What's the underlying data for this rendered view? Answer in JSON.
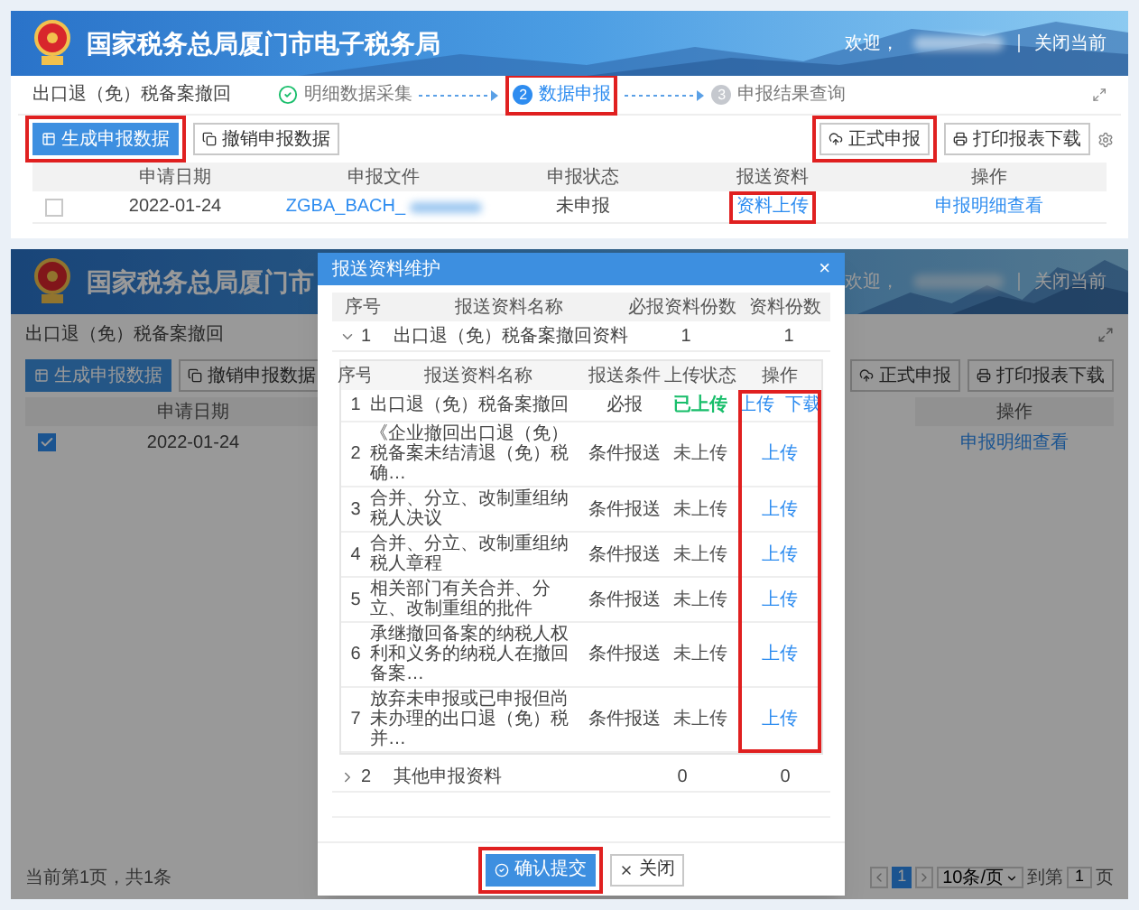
{
  "top_screen": {
    "header": {
      "title": "国家税务总局厦门市电子税务局",
      "welcome": "欢迎，",
      "logout": "关闭当前"
    },
    "breadcrumb": "出口退（免）税备案撤回",
    "steps": [
      {
        "label": "明细数据采集",
        "done": true,
        "selected": false,
        "highlighted": false
      },
      {
        "number": "2",
        "label": "数据申报",
        "done": false,
        "selected": true,
        "highlighted": true
      },
      {
        "number": "3",
        "label": "申报结果查询",
        "done": false,
        "selected": false,
        "highlighted": false
      }
    ],
    "toolbar_left": [
      {
        "label": "生成申报数据",
        "kind": "primary",
        "highlighted": true
      },
      {
        "label": "撤销申报数据",
        "kind": "default",
        "highlighted": false
      }
    ],
    "toolbar_right": [
      {
        "label": "正式申报",
        "kind": "default",
        "highlighted": true
      },
      {
        "label": "打印报表下载",
        "kind": "default",
        "highlighted": false
      }
    ],
    "columns": [
      "申请日期",
      "申报文件",
      "申报状态",
      "报送资料",
      "操作"
    ],
    "rows": [
      {
        "checked": false,
        "date": "2022-01-24",
        "file": "ZGBA_BACH_",
        "status": "未申报",
        "material": "资料上传",
        "material_highlighted": true,
        "action": "申报明细查看"
      }
    ]
  },
  "bottom_screen": {
    "header": {
      "title": "国家税务总局厦门市",
      "welcome": "欢迎，",
      "logout": "关闭当前"
    },
    "breadcrumb": "出口退（免）税备案撤回",
    "toolbar_left": [
      {
        "label": "生成申报数据",
        "kind": "primary",
        "highlighted": false
      },
      {
        "label": "撤销申报数据",
        "kind": "default",
        "highlighted": false
      }
    ],
    "toolbar_right": [
      {
        "label": "正式申报",
        "kind": "default",
        "highlighted": false
      },
      {
        "label": "打印报表下载",
        "kind": "default",
        "highlighted": false
      }
    ],
    "column_left": "申请日期",
    "column_right": "操作",
    "rows": [
      {
        "checked": true,
        "date": "2022-01-24",
        "action": "申报明细查看"
      }
    ],
    "footer": "当前第1页，共1条",
    "pagination": {
      "page": "1",
      "page_size": "10条/页",
      "goto_label": "到第",
      "goto_value": "1",
      "page_label": "页"
    },
    "modal": {
      "title": "报送资料维护",
      "close": "×",
      "columns": [
        "序号",
        "报送资料名称",
        "必报资料份数",
        "资料份数"
      ],
      "groups": [
        {
          "index": "1",
          "name": "出口退（免）税备案撤回资料",
          "required": "1",
          "count": "1",
          "expanded": true,
          "sub_columns": [
            "序号",
            "报送资料名称",
            "报送条件",
            "上传状态",
            "操作"
          ],
          "actions_highlighted": true,
          "items": [
            {
              "index": "1",
              "name": "出口退（免）税备案撤回",
              "condition": "必报",
              "status": "已上传",
              "uploaded": true,
              "actions": [
                "上传",
                "下载"
              ]
            },
            {
              "index": "2",
              "name": "《企业撤回出口退（免）税备案未结清退（免）税确…",
              "condition": "条件报送",
              "status": "未上传",
              "uploaded": false,
              "actions": [
                "上传"
              ]
            },
            {
              "index": "3",
              "name": "合并、分立、改制重组纳税人决议",
              "condition": "条件报送",
              "status": "未上传",
              "uploaded": false,
              "actions": [
                "上传"
              ]
            },
            {
              "index": "4",
              "name": "合并、分立、改制重组纳税人章程",
              "condition": "条件报送",
              "status": "未上传",
              "uploaded": false,
              "actions": [
                "上传"
              ]
            },
            {
              "index": "5",
              "name": "相关部门有关合并、分立、改制重组的批件",
              "condition": "条件报送",
              "status": "未上传",
              "uploaded": false,
              "actions": [
                "上传"
              ]
            },
            {
              "index": "6",
              "name": "承继撤回备案的纳税人权利和义务的纳税人在撤回备案…",
              "condition": "条件报送",
              "status": "未上传",
              "uploaded": false,
              "actions": [
                "上传"
              ]
            },
            {
              "index": "7",
              "name": "放弃未申报或已申报但尚未办理的出口退（免）税并…",
              "condition": "条件报送",
              "status": "未上传",
              "uploaded": false,
              "actions": [
                "上传"
              ]
            }
          ]
        },
        {
          "index": "2",
          "name": "其他申报资料",
          "required": "0",
          "count": "0",
          "expanded": false
        }
      ],
      "buttons": [
        {
          "label": "确认提交",
          "kind": "primary",
          "highlighted": true
        },
        {
          "label": "关闭",
          "kind": "default",
          "highlighted": false
        }
      ]
    }
  }
}
